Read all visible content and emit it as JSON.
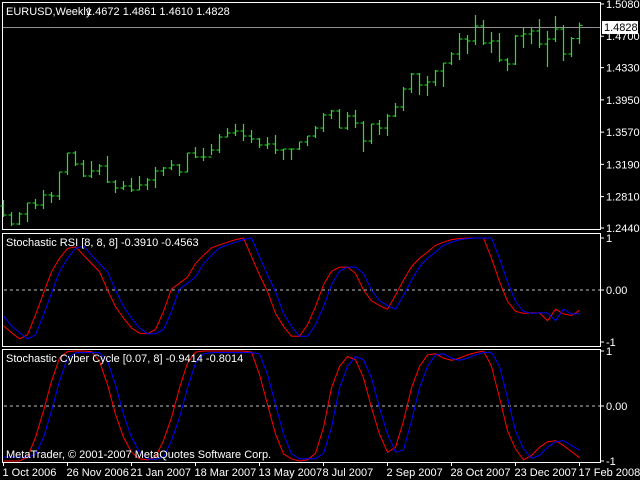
{
  "header": {
    "symbol": "EURUSD,Weekly",
    "ohlc_text": "1.4672 1.4861 1.4610 1.4828"
  },
  "footer": {
    "copyright": "MetaTrader, © 2001-2007 MetaQuotes Software Corp."
  },
  "colors": {
    "background": "#000000",
    "bars": "#22e622",
    "main_line": "#ff0000",
    "signal_line": "#0000ff",
    "frame": "#ffffff",
    "zero_line": "#c0c0c0",
    "price_line": "#909090"
  },
  "chart_data": [
    {
      "type": "ohlc",
      "title": "EURUSD,Weekly",
      "ylim": [
        1.244,
        1.508
      ],
      "yticks": [
        "1.5080",
        "1.4700",
        "1.4330",
        "1.3950",
        "1.3570",
        "1.3190",
        "1.2810",
        "1.2440"
      ],
      "current_price": "1.4828",
      "first_open": 1.27,
      "high": [
        1.277,
        1.2628,
        1.2628,
        1.2735,
        1.2782,
        1.2888,
        1.2864,
        1.31,
        1.3324,
        1.3347,
        1.3241,
        1.3229,
        1.3194,
        1.3288,
        1.3006,
        1.2994,
        1.3029,
        1.3053,
        1.3029,
        1.3159,
        1.3159,
        1.3241,
        1.3194,
        1.3324,
        1.3394,
        1.3383,
        1.343,
        1.3548,
        1.3618,
        1.3666,
        1.3666,
        1.3595,
        1.3501,
        1.3512,
        1.3536,
        1.3371,
        1.3371,
        1.3454,
        1.3524,
        1.3642,
        1.3795,
        1.3831,
        1.3842,
        1.3807,
        1.3831,
        1.3701,
        1.3666,
        1.3713,
        1.3783,
        1.3913,
        1.4102,
        1.4267,
        1.4267,
        1.4231,
        1.4302,
        1.4384,
        1.4514,
        1.4738,
        1.4714,
        1.495,
        1.4891,
        1.475,
        1.4738,
        1.4443,
        1.4714,
        1.4797,
        1.4797,
        1.4903,
        1.4762,
        1.4938,
        1.4832,
        1.4691,
        1.4861
      ],
      "low": [
        1.257,
        1.2463,
        1.2475,
        1.2511,
        1.2664,
        1.2664,
        1.2735,
        1.277,
        1.3064,
        1.3171,
        1.3041,
        1.3029,
        1.3064,
        1.297,
        1.2852,
        1.2888,
        1.2864,
        1.2888,
        1.2888,
        1.2911,
        1.3053,
        1.3123,
        1.3053,
        1.31,
        1.3265,
        1.3229,
        1.33,
        1.3324,
        1.3512,
        1.3524,
        1.3465,
        1.3442,
        1.3383,
        1.3371,
        1.3312,
        1.3241,
        1.3241,
        1.3359,
        1.3406,
        1.3501,
        1.3571,
        1.3725,
        1.3618,
        1.3595,
        1.3618,
        1.3336,
        1.343,
        1.3536,
        1.3524,
        1.3748,
        1.3819,
        1.4031,
        1.4007,
        1.3996,
        1.4113,
        1.4102,
        1.4361,
        1.442,
        1.4491,
        1.4597,
        1.4597,
        1.4502,
        1.4396,
        1.429,
        1.4361,
        1.4561,
        1.4608,
        1.4561,
        1.4337,
        1.4632,
        1.4408,
        1.4455,
        1.461
      ],
      "close": [
        1.2593,
        1.2487,
        1.2605,
        1.2735,
        1.2711,
        1.2829,
        1.2817,
        1.31,
        1.3324,
        1.3194,
        1.3053,
        1.3112,
        1.3171,
        1.2982,
        1.2911,
        1.2935,
        1.2888,
        1.2947,
        1.3006,
        1.3112,
        1.3147,
        1.3182,
        1.31,
        1.3324,
        1.3277,
        1.3277,
        1.3359,
        1.3512,
        1.356,
        1.3583,
        1.3524,
        1.3489,
        1.3418,
        1.343,
        1.3359,
        1.3371,
        1.3371,
        1.3454,
        1.3524,
        1.3618,
        1.3772,
        1.3819,
        1.3618,
        1.376,
        1.3677,
        1.3465,
        1.3666,
        1.3618,
        1.376,
        1.3866,
        1.4078,
        1.4255,
        1.4125,
        1.4161,
        1.429,
        1.4384,
        1.4491,
        1.4667,
        1.4644,
        1.4821,
        1.462,
        1.4644,
        1.442,
        1.4373,
        1.4703,
        1.4726,
        1.4762,
        1.4608,
        1.4667,
        1.4785,
        1.4491,
        1.4672,
        1.4828
      ]
    },
    {
      "type": "line",
      "title": "Stochastic RSI [8, 8, 8] -0.3910 -0.4563",
      "ylim": [
        -1,
        1
      ],
      "yticks": [
        "1",
        "0.00",
        "-1"
      ],
      "series": [
        {
          "name": "main",
          "values": [
            -0.69,
            -0.82,
            -0.94,
            -0.86,
            -0.48,
            -0.06,
            0.35,
            0.61,
            0.8,
            0.83,
            0.67,
            0.51,
            0.35,
            0.0,
            -0.32,
            -0.54,
            -0.73,
            -0.83,
            -0.84,
            -0.76,
            -0.41,
            0.02,
            0.13,
            0.25,
            0.51,
            0.67,
            0.81,
            0.87,
            0.92,
            0.97,
            1.0,
            0.64,
            0.29,
            -0.03,
            -0.45,
            -0.7,
            -0.89,
            -0.89,
            -0.67,
            -0.32,
            0.1,
            0.36,
            0.44,
            0.44,
            0.32,
            0.0,
            -0.21,
            -0.3,
            -0.37,
            -0.1,
            0.19,
            0.45,
            0.61,
            0.73,
            0.86,
            0.92,
            0.97,
            0.99,
            1.0,
            1.0,
            1.0,
            0.61,
            0.16,
            -0.22,
            -0.41,
            -0.45,
            -0.44,
            -0.44,
            -0.59,
            -0.37,
            -0.46,
            -0.49,
            -0.391
          ]
        },
        {
          "name": "signal",
          "values": [
            -0.5,
            -0.69,
            -0.82,
            -0.94,
            -0.86,
            -0.48,
            -0.06,
            0.35,
            0.61,
            0.8,
            0.85,
            0.67,
            0.51,
            0.35,
            0.0,
            -0.32,
            -0.54,
            -0.73,
            -0.84,
            -0.84,
            -0.76,
            -0.41,
            0.02,
            0.13,
            0.25,
            0.51,
            0.67,
            0.81,
            0.87,
            0.92,
            0.97,
            1.0,
            0.64,
            0.29,
            -0.03,
            -0.45,
            -0.7,
            -0.89,
            -0.89,
            -0.67,
            -0.32,
            0.1,
            0.36,
            0.44,
            0.44,
            0.32,
            0.0,
            -0.21,
            -0.3,
            -0.37,
            -0.1,
            0.19,
            0.45,
            0.61,
            0.73,
            0.86,
            0.92,
            0.97,
            0.99,
            1.0,
            1.0,
            1.0,
            0.61,
            0.16,
            -0.22,
            -0.41,
            -0.45,
            -0.44,
            -0.44,
            -0.59,
            -0.37,
            -0.46,
            -0.4563
          ]
        }
      ]
    },
    {
      "type": "line",
      "title": "Stochastic Cyber Cycle [0.07, 8] -0.9414 -0.8014",
      "ylim": [
        -1,
        1
      ],
      "yticks": [
        "1",
        "0.00",
        "-1"
      ],
      "series": [
        {
          "name": "main",
          "values": [
            -1.0,
            -1.0,
            -1.0,
            -0.93,
            -0.57,
            -0.09,
            0.45,
            0.87,
            0.99,
            1.0,
            1.0,
            0.99,
            0.81,
            0.39,
            -0.15,
            -0.57,
            -0.84,
            -0.96,
            -0.98,
            -0.93,
            -0.63,
            -0.21,
            0.33,
            0.78,
            0.98,
            1.0,
            1.0,
            1.0,
            1.0,
            1.0,
            1.0,
            0.98,
            0.57,
            0.03,
            -0.51,
            -0.87,
            -0.96,
            -1.0,
            -0.98,
            -0.86,
            -0.39,
            0.33,
            0.72,
            0.9,
            0.84,
            0.51,
            -0.03,
            -0.51,
            -0.84,
            -0.75,
            -0.27,
            0.33,
            0.72,
            0.93,
            0.95,
            0.87,
            0.83,
            0.87,
            0.93,
            0.97,
            1.0,
            0.72,
            0.15,
            -0.45,
            -0.78,
            -0.98,
            -0.9,
            -0.75,
            -0.65,
            -0.63,
            -0.72,
            -0.83,
            -0.9414
          ]
        },
        {
          "name": "signal",
          "values": [
            -0.93,
            -0.93,
            -0.93,
            -0.93,
            -0.88,
            -0.57,
            -0.09,
            0.45,
            0.87,
            0.97,
            0.97,
            0.97,
            0.97,
            0.81,
            0.39,
            -0.15,
            -0.57,
            -0.84,
            -0.96,
            -0.97,
            -0.93,
            -0.63,
            -0.21,
            0.33,
            0.78,
            0.95,
            0.97,
            0.97,
            0.97,
            0.97,
            0.97,
            0.97,
            0.95,
            0.57,
            0.03,
            -0.51,
            -0.87,
            -0.96,
            -0.96,
            -0.96,
            -0.86,
            -0.39,
            0.33,
            0.72,
            0.9,
            0.84,
            0.51,
            -0.03,
            -0.51,
            -0.84,
            -0.8,
            -0.27,
            0.33,
            0.72,
            0.93,
            0.95,
            0.87,
            0.83,
            0.87,
            0.93,
            0.97,
            0.98,
            0.72,
            0.15,
            -0.45,
            -0.78,
            -0.95,
            -0.9,
            -0.75,
            -0.65,
            -0.63,
            -0.72,
            -0.8014
          ]
        }
      ]
    }
  ],
  "xaxis": {
    "labels": [
      "1 Oct 2006",
      "26 Nov 2006",
      "21 Jan 2007",
      "18 Mar 2007",
      "13 May 2007",
      "8 Jul 2007",
      "2 Sep 2007",
      "28 Oct 2007",
      "23 Dec 2007",
      "17 Feb 2008"
    ],
    "label_every_bars": 8
  }
}
